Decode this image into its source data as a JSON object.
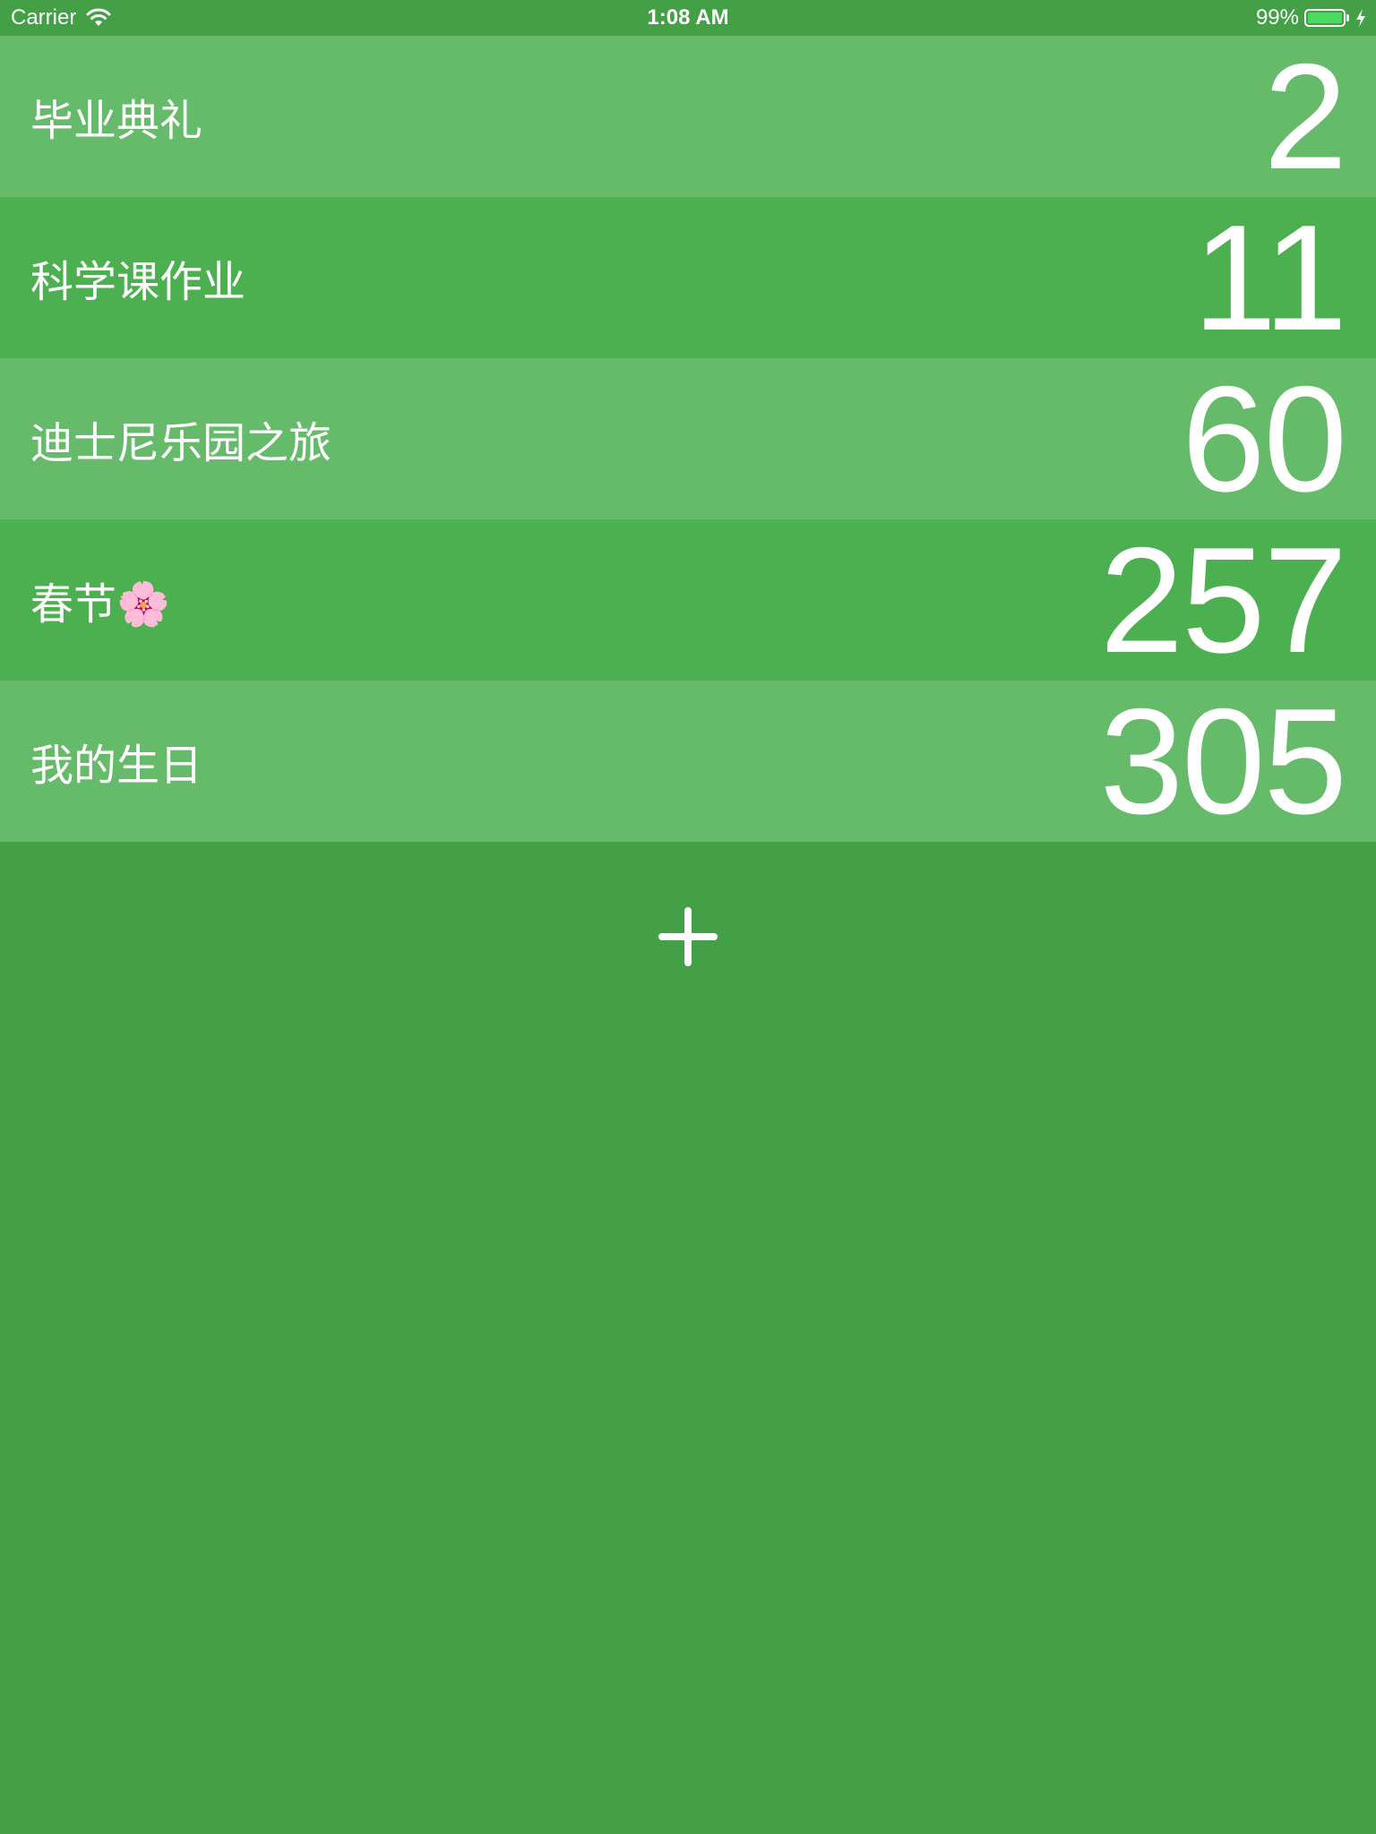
{
  "status_bar": {
    "carrier": "Carrier",
    "time": "1:08 AM",
    "battery": "99%",
    "battery_level": 0.99,
    "battery_fill_color": "#4cd964",
    "wifi_icon": "wifi-icon",
    "charging_icon": "bolt-icon"
  },
  "colors": {
    "background": "#43a047",
    "row_light": "#66bb6a",
    "row_dark": "#4caf50",
    "text": "#ffffff"
  },
  "events": [
    {
      "name": "毕业典礼",
      "days": "2"
    },
    {
      "name": "科学课作业",
      "days": "11"
    },
    {
      "name": "迪士尼乐园之旅",
      "days": "60"
    },
    {
      "name": "春节🌸",
      "days": "257"
    },
    {
      "name": "我的生日",
      "days": "305"
    }
  ],
  "add_button": {
    "icon": "plus-icon"
  }
}
